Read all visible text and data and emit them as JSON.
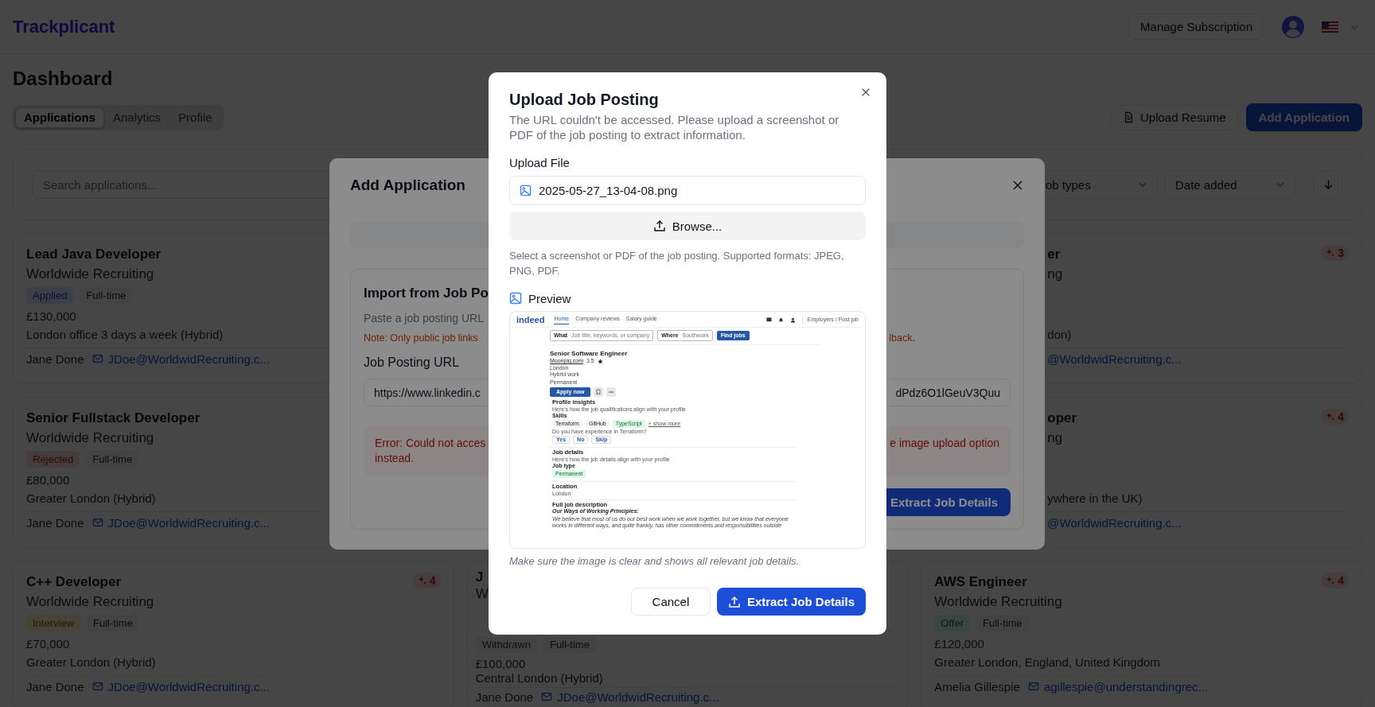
{
  "header": {
    "logo": "Trackplicant",
    "manage_button": "Manage Subscription"
  },
  "page": {
    "title": "Dashboard",
    "upload_resume_button": "Upload Resume",
    "add_button": "Add Application"
  },
  "tabs": [
    {
      "label": "Applications",
      "selected": true
    },
    {
      "label": "Analytics",
      "selected": false
    },
    {
      "label": "Profile",
      "selected": false
    }
  ],
  "filters": {
    "search_placeholder": "Search applications...",
    "job_type": "ob types",
    "sort": "Date added"
  },
  "cards": {
    "left": [
      {
        "title": "Lead Java Developer",
        "company": "Worldwide Recruiting",
        "status": {
          "label": "Applied",
          "kind": "applied"
        },
        "type": "Full-time",
        "salary": "£130,000",
        "location": "London office 3 days a week (Hybrid)",
        "contact": "Jane Done",
        "email": "JDoe@WorldwidRecruiting.c..."
      },
      {
        "title": "Senior Fullstack Developer",
        "company": "Worldwide Recruiting",
        "status": {
          "label": "Rejected",
          "kind": "rejected"
        },
        "type": "Full-time",
        "salary": "£80,000",
        "location": "Greater London (Hybrid)",
        "contact": "Jane Done",
        "email": "JDoe@WorldwidRecruiting.c..."
      },
      {
        "title": "C++ Developer",
        "company": "Worldwide Recruiting",
        "score": "4",
        "status": {
          "label": "Interview",
          "kind": "interview"
        },
        "type": "Full-time",
        "salary": "£70,000",
        "location": "Greater London (Hybrid)",
        "contact": "Jane Done",
        "email": "JDoe@WorldwidRecruiting.c..."
      }
    ],
    "middle": [
      {
        "title": "J",
        "company": "W",
        "status": {
          "label": "Withdrawn",
          "kind": "withdrawn"
        },
        "type": "Full-time",
        "salary": "£100,000",
        "location": "Central London (Hybrid)",
        "contact": "Jane Done",
        "email": "JDoe@WorldwidRecruiting.c..."
      }
    ],
    "right": [
      {
        "clipped": true,
        "title": "er",
        "company": "ng",
        "score": "3",
        "location": "don)",
        "email": "@WorldwidRecruiting.c..."
      },
      {
        "clipped": true,
        "title": "oper",
        "company": "ng",
        "score": "4",
        "location": "ywhere in the UK)",
        "email": "@WorldwidRecruiting.c..."
      },
      {
        "title": "AWS Engineer",
        "company": "Worldwide Recruiting",
        "score": "4",
        "status": {
          "label": "Offer",
          "kind": "offer"
        },
        "type": "Full-time",
        "salary": "£120,000",
        "location": "Greater London, England, United Kingdom",
        "contact": "Amelia Gillespie",
        "email": "agillespie@understandingrec..."
      }
    ]
  },
  "add_dialog": {
    "title": "Add Application",
    "section_title": "Import from Job Po",
    "section_text": "Paste a job posting URL",
    "note_left": "Note: Only public job links",
    "note_right": "lback.",
    "url_label": "Job Posting URL",
    "url_left": "https://www.linkedin.c",
    "url_right": "dPdz6O1lGeuV3Quu",
    "error_left": "Error: Could not acces",
    "error_right": "e image upload option",
    "error_line2": "instead.",
    "extract_button": "Extract Job Details"
  },
  "upload_dialog": {
    "title": "Upload Job Posting",
    "description": "The URL couldn't be accessed. Please upload a screenshot or PDF of the job posting to extract information.",
    "file_label": "Upload File",
    "file_name": "2025-05-27_13-04-08.png",
    "browse_button": "Browse...",
    "help_text": "Select a screenshot or PDF of the job posting. Supported formats: JPEG, PNG, PDF.",
    "preview_label": "Preview",
    "caption": "Make sure the image is clear and shows all relevant job details.",
    "cancel_button": "Cancel",
    "extract_button": "Extract Job Details"
  },
  "preview": {
    "logo": "indeed",
    "nav": [
      {
        "label": "Home",
        "selected": true
      },
      {
        "label": "Company reviews",
        "selected": false
      },
      {
        "label": "Salary guide",
        "selected": false
      }
    ],
    "employers": "Employers / Post job",
    "what_label": "What",
    "what_placeholder": "Job title, keywords, or company",
    "where_label": "Where",
    "where_value": "Southwark",
    "find_button": "Find jobs",
    "job_title": "Senior Software Engineer",
    "company": "Moonpig.com",
    "rating": "3.5",
    "location": "London",
    "work_mode": "Hybrid work",
    "job_type": "Permanent",
    "apply_button": "Apply now",
    "insights_title": "Profile insights",
    "insights_text": "Here's how the job qualifications align with your profile",
    "skills_label": "Skills",
    "skills": [
      {
        "label": "Terraform",
        "matched": false
      },
      {
        "label": "GitHub",
        "matched": false
      },
      {
        "label": "TypeScript",
        "matched": true
      }
    ],
    "show_more": "+ show more",
    "question": "Do you have experience in Terraform?",
    "answers": [
      "Yes",
      "No",
      "Skip"
    ],
    "details_title": "Job details",
    "details_text": "Here's how the job details align with your profile",
    "job_type_label": "Job type",
    "job_type_chip": "Permanent",
    "location_title": "Location",
    "location_value": "London",
    "description_title": "Full job description",
    "description_subtitle": "Our Ways of Working Principles:",
    "description_text": "We believe that most of us do our best work when we work together, but we know that everyone works in different ways, and quite frankly, has other commitments and responsibilities outside"
  }
}
